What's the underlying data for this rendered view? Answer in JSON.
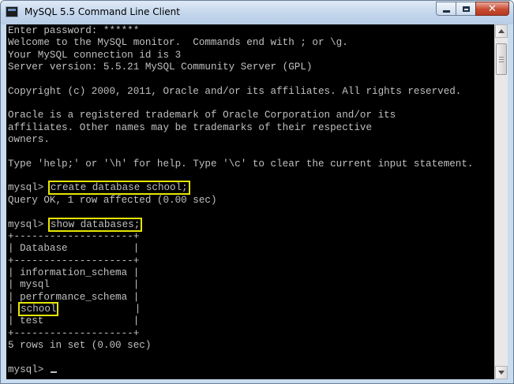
{
  "window": {
    "title": "MySQL 5.5 Command Line Client"
  },
  "colors": {
    "console_bg": "#000000",
    "console_text": "#c0c0c0",
    "highlight": "#e6e600"
  },
  "icons": {
    "app": "mysql-console-icon",
    "minimize": "minimize-icon",
    "maximize": "maximize-icon",
    "close": "close-icon"
  },
  "console": {
    "lines": [
      {
        "text": "Enter password: ******"
      },
      {
        "text": "Welcome to the MySQL monitor.  Commands end with ; or \\g."
      },
      {
        "text": "Your MySQL connection id is 3"
      },
      {
        "text": "Server version: 5.5.21 MySQL Community Server (GPL)"
      },
      {
        "text": ""
      },
      {
        "text": "Copyright (c) 2000, 2011, Oracle and/or its affiliates. All rights reserved."
      },
      {
        "text": ""
      },
      {
        "text": "Oracle is a registered trademark of Oracle Corporation and/or its"
      },
      {
        "text": "affiliates. Other names may be trademarks of their respective"
      },
      {
        "text": "owners."
      },
      {
        "text": ""
      },
      {
        "text": "Type 'help;' or '\\h' for help. Type '\\c' to clear the current input statement."
      },
      {
        "text": ""
      },
      {
        "prefix": "mysql> ",
        "highlight": "create database school;"
      },
      {
        "text": "Query OK, 1 row affected (0.00 sec)"
      },
      {
        "text": ""
      },
      {
        "prefix": "mysql> ",
        "highlight": "show databases;"
      },
      {
        "text": "+--------------------+"
      },
      {
        "text": "| Database           |"
      },
      {
        "text": "+--------------------+"
      },
      {
        "text": "| information_schema |"
      },
      {
        "text": "| mysql              |"
      },
      {
        "text": "| performance_schema |"
      },
      {
        "prefix": "| ",
        "highlight": "school",
        "suffix": "             |"
      },
      {
        "text": "| test               |"
      },
      {
        "text": "+--------------------+"
      },
      {
        "text": "5 rows in set (0.00 sec)"
      },
      {
        "text": ""
      },
      {
        "prefix": "mysql> ",
        "cursor": true
      }
    ]
  }
}
